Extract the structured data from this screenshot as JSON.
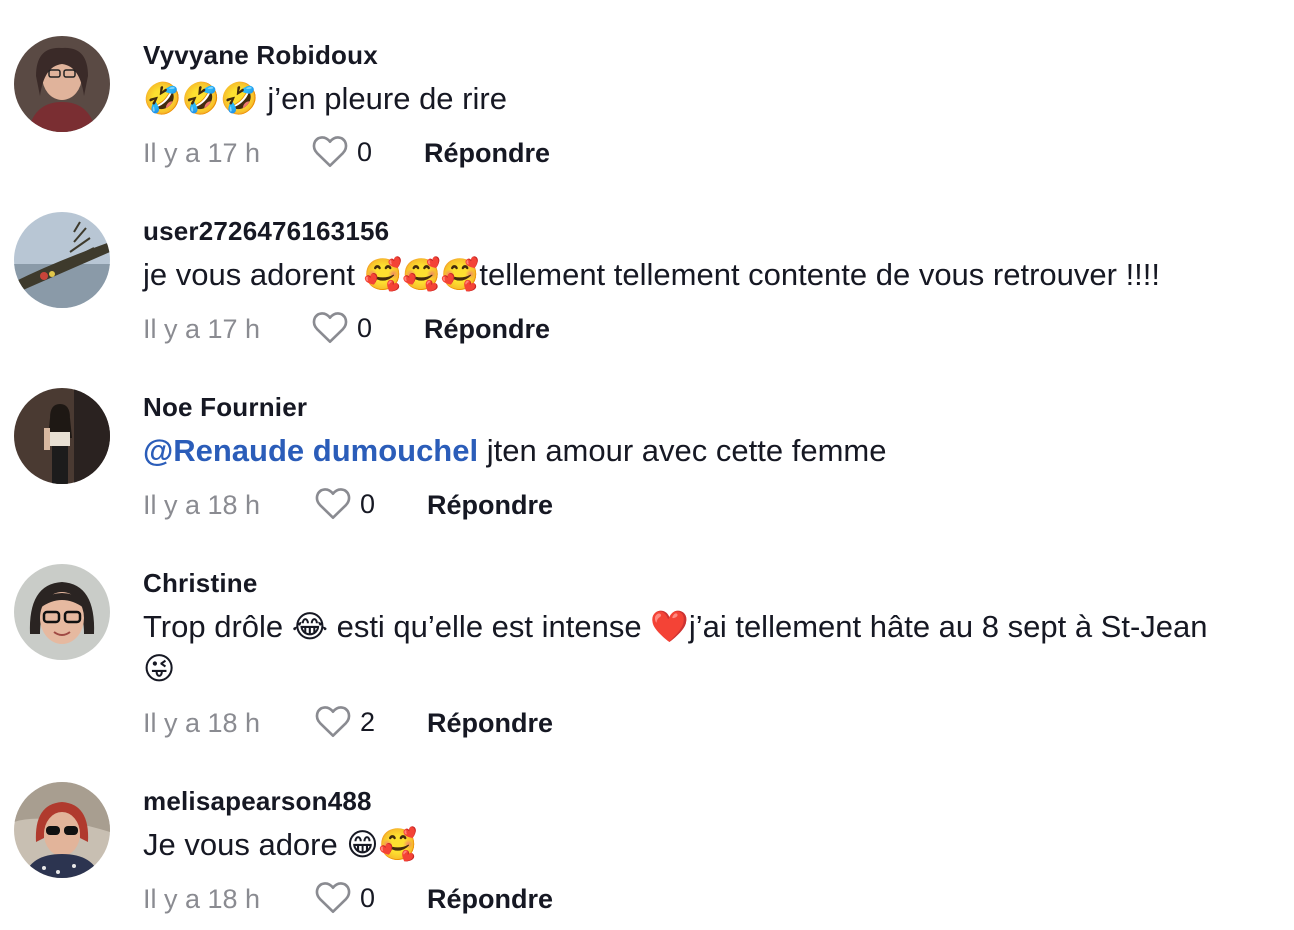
{
  "comments": [
    {
      "username": "Vyvyane Robidoux",
      "mention": "",
      "text": "🤣🤣🤣 j’en pleure de rire",
      "time": "Il y a 17 h",
      "likes": "0",
      "reply_label": "Répondre",
      "avatar_colors": [
        "#3a2a28",
        "#d9a58e",
        "#6b2d2d"
      ]
    },
    {
      "username": "user2726476163156",
      "mention": "",
      "text": "je vous adorent 🥰🥰🥰tellement tellement contente de vous retrouver !!!!",
      "time": "Il y a 17 h",
      "likes": "0",
      "reply_label": "Répondre",
      "avatar_colors": [
        "#9fb3c7",
        "#4a4a3a",
        "#c9d3dc"
      ]
    },
    {
      "username": "Noe Fournier",
      "mention": "@Renaude dumouchel",
      "text": " jten amour avec cette femme",
      "time": "Il y a 18 h",
      "likes": "0",
      "reply_label": "Répondre",
      "avatar_colors": [
        "#2d2520",
        "#d8b8a0",
        "#1c1c1c"
      ]
    },
    {
      "username": "Christine",
      "mention": "",
      "text": "Trop drôle 😂 esti qu’elle est intense ❤️j’ai tellement hâte au 8 sept à St-Jean 😜",
      "time": "Il y a 18 h",
      "likes": "2",
      "reply_label": "Répondre",
      "avatar_colors": [
        "#c9ccc8",
        "#2a2422",
        "#e6b9a0"
      ]
    },
    {
      "username": "melisapearson488",
      "mention": "",
      "text": "Je vous adore 😁🥰",
      "time": "Il y a 18 h",
      "likes": "0",
      "reply_label": "Répondre",
      "avatar_colors": [
        "#c8bfb2",
        "#b03a2e",
        "#2c3450"
      ]
    }
  ],
  "colors": {
    "text": "#161823",
    "muted": "#8a8b91",
    "mention": "#2b5db9"
  },
  "icons": {
    "like": "heart-outline-icon"
  }
}
